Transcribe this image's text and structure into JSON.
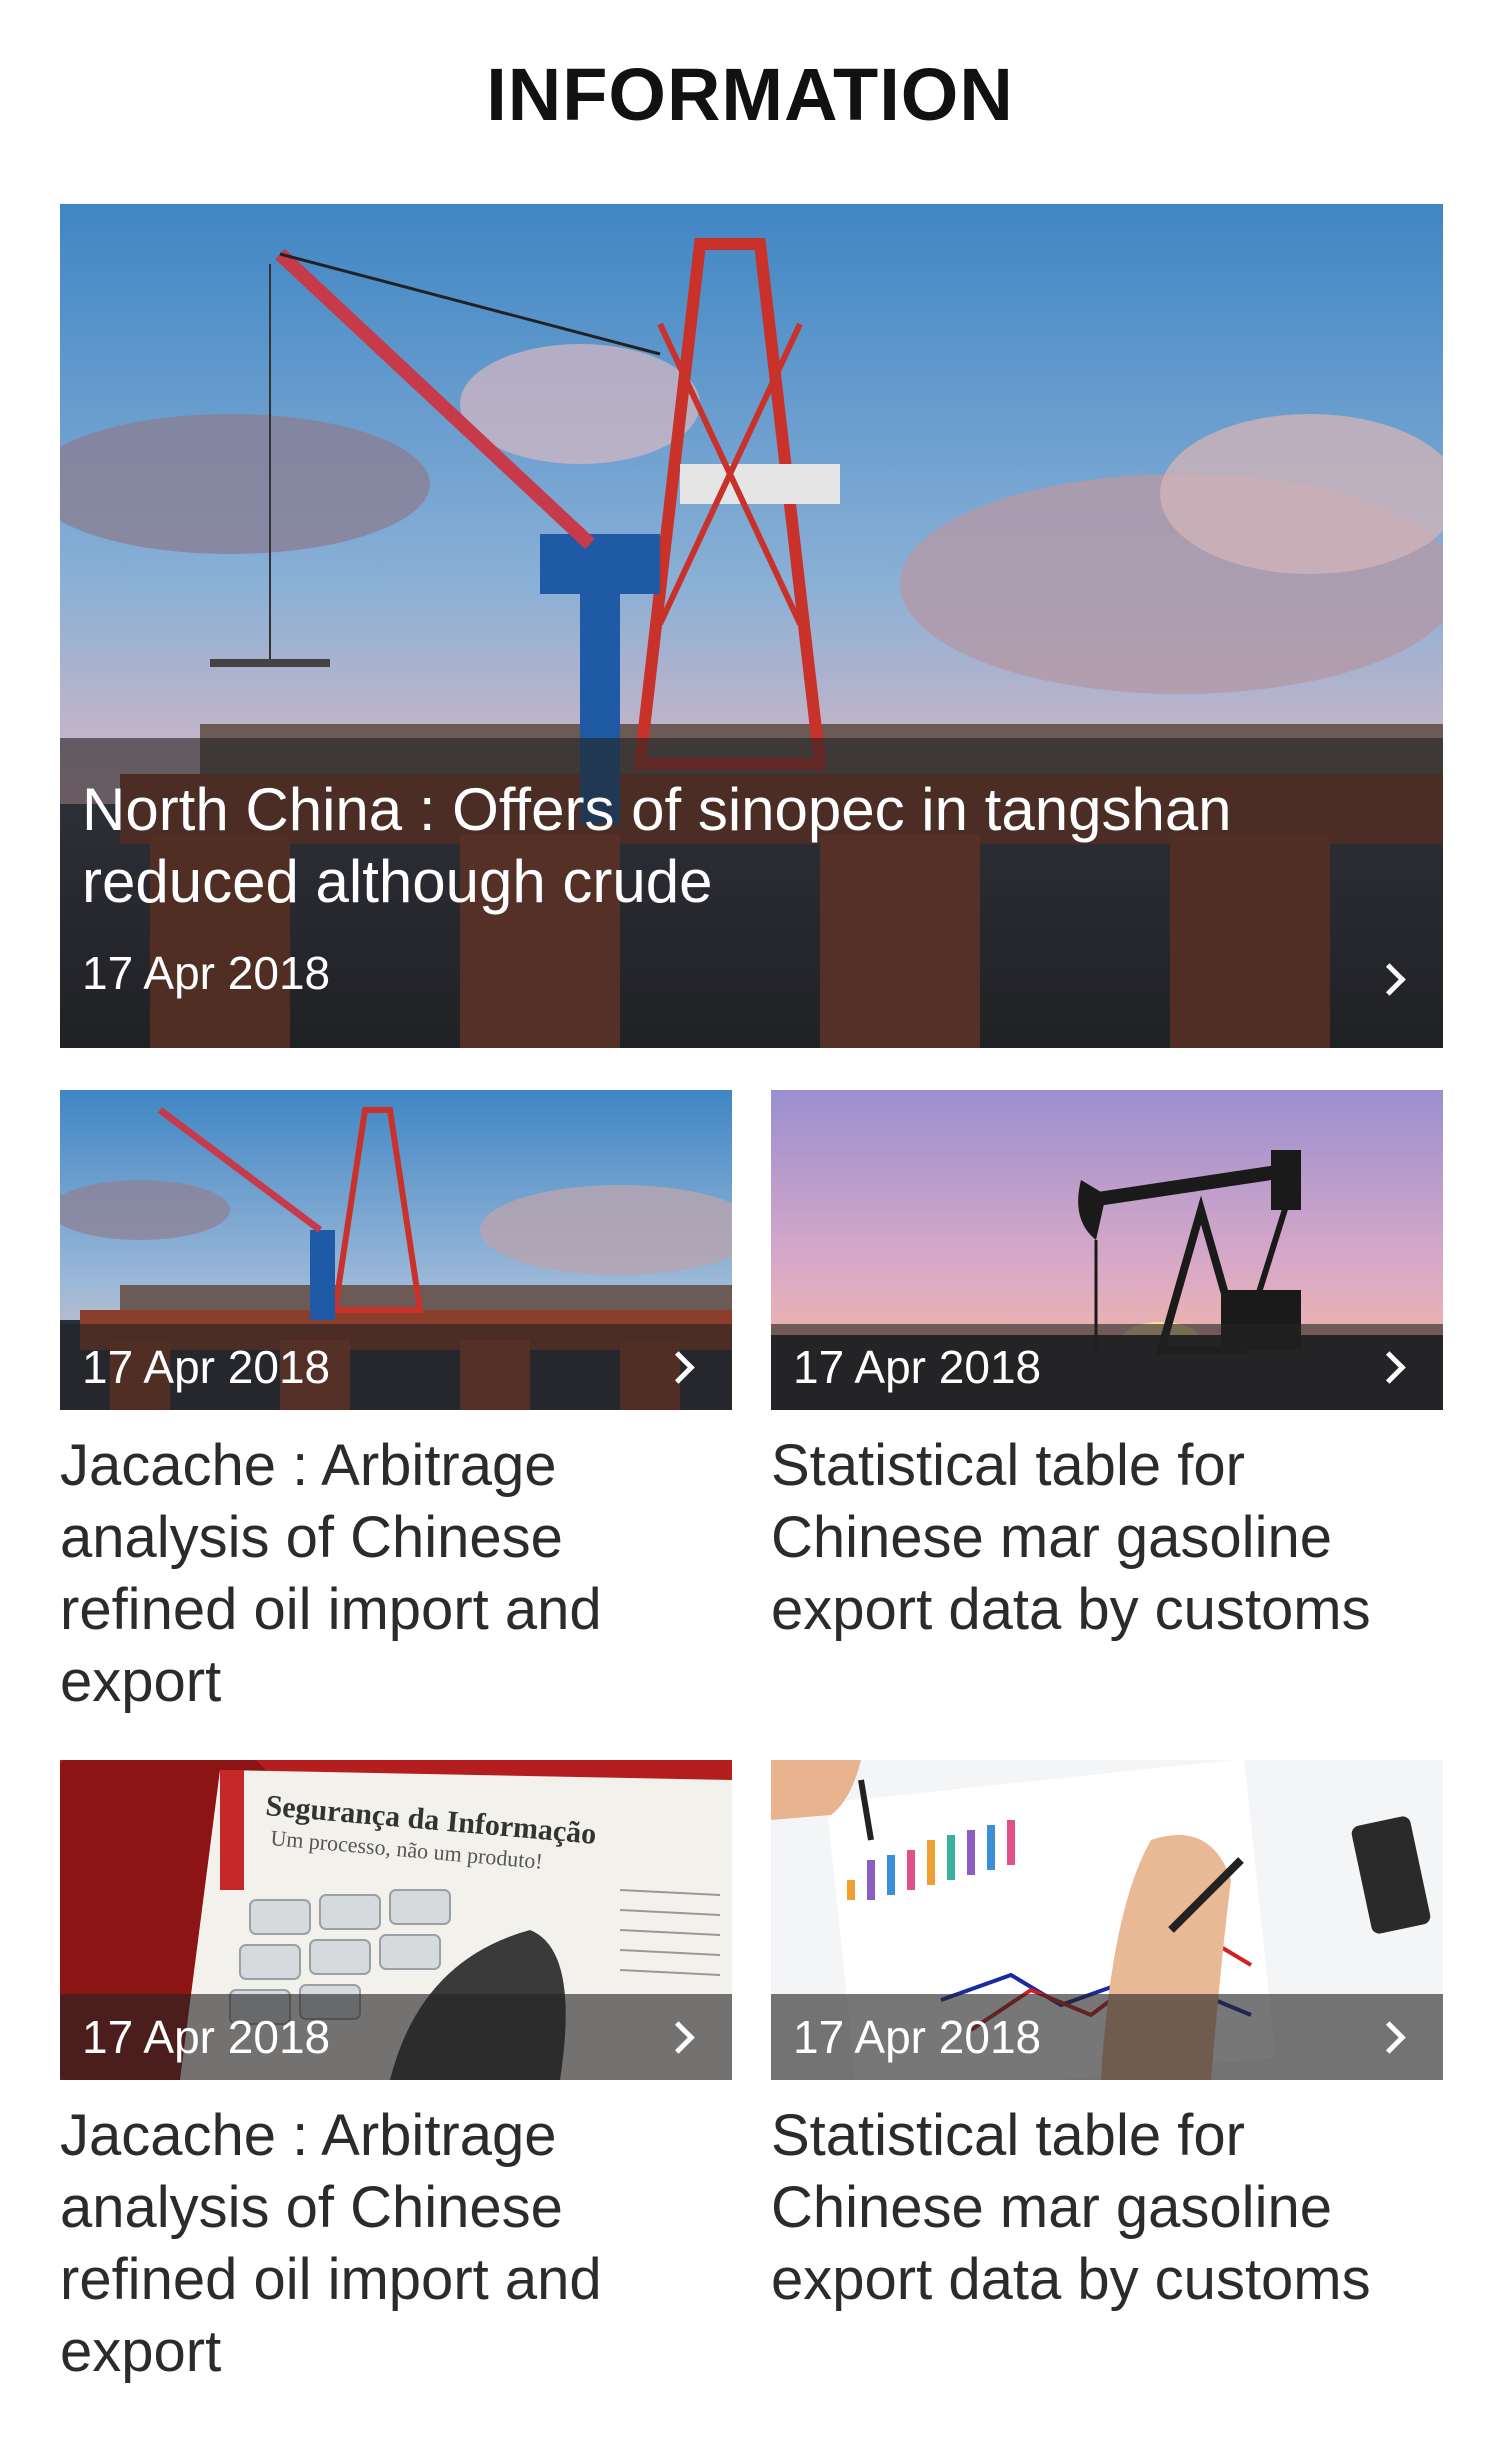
{
  "page": {
    "title": "INFORMATION"
  },
  "hero": {
    "title": "North China : Offers of sinopec in tangshan reduced although crude",
    "date": "17 Apr 2018",
    "image_icon": "offshore-rig-image"
  },
  "cards": [
    {
      "date": "17 Apr 2018",
      "title": "Jacache : Arbitrage analysis of Chinese refined oil import and export",
      "image_icon": "offshore-rig-image"
    },
    {
      "date": "17 Apr 2018",
      "title": "Statistical table for Chinese mar gasoline export data by customs",
      "image_icon": "oil-pump-sunset-image"
    },
    {
      "date": "17 Apr 2018",
      "title": "Jacache : Arbitrage analysis of Chinese refined oil import and export",
      "image_icon": "security-magazine-image",
      "image_text": {
        "heading": "Segurança da Informação",
        "subheading": "Um processo, não um produto!"
      }
    },
    {
      "date": "17 Apr 2018",
      "title": "Statistical table for Chinese mar gasoline export data by customs",
      "image_icon": "chart-analysis-image"
    }
  ],
  "colors": {
    "overlay": "#232323",
    "text": "#2b2b2b",
    "sky_top": "#3f86c4",
    "sunset_pink": "#e8b0c0",
    "rig_red": "#a83a24",
    "rig_blue": "#1e5aa6"
  }
}
